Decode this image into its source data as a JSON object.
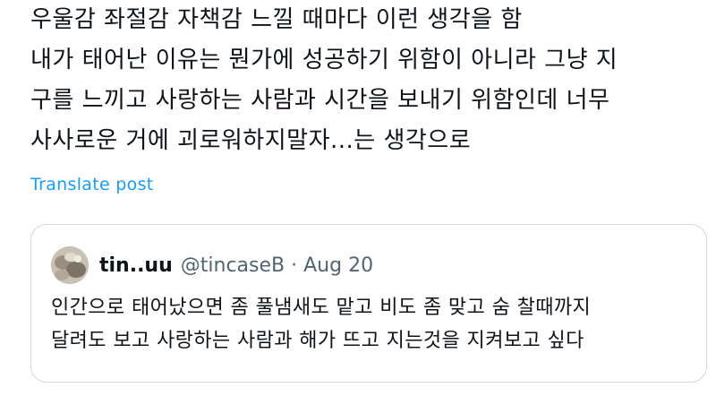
{
  "post": {
    "lines": [
      "우울감 좌절감 자책감 느낄 때마다 이런 생각을 함",
      "내가 태어난 이유는 뭔가에 성공하기 위함이 아니라 그냥 지",
      "구를 느끼고 사랑하는 사람과 시간을 보내기 위함인데 너무",
      "사사로운 거에 괴로워하지말자...는 생각으로"
    ],
    "translate_label": "Translate post"
  },
  "quote": {
    "avatar_icon": "avatar-photo-icon",
    "display_name": "tin..uu",
    "handle": "@tincaseB",
    "separator": "·",
    "date": "Aug 20",
    "lines": [
      "인간으로 태어났으면 좀 풀냄새도 맡고 비도 좀 맞고 숨 찰때까지",
      "달려도 보고 사랑하는 사람과 해가 뜨고 지는것을 지켜보고 싶다"
    ]
  },
  "colors": {
    "text": "#0f1419",
    "secondary": "#536471",
    "link": "#1d9bf0",
    "border": "#cfd9de"
  }
}
